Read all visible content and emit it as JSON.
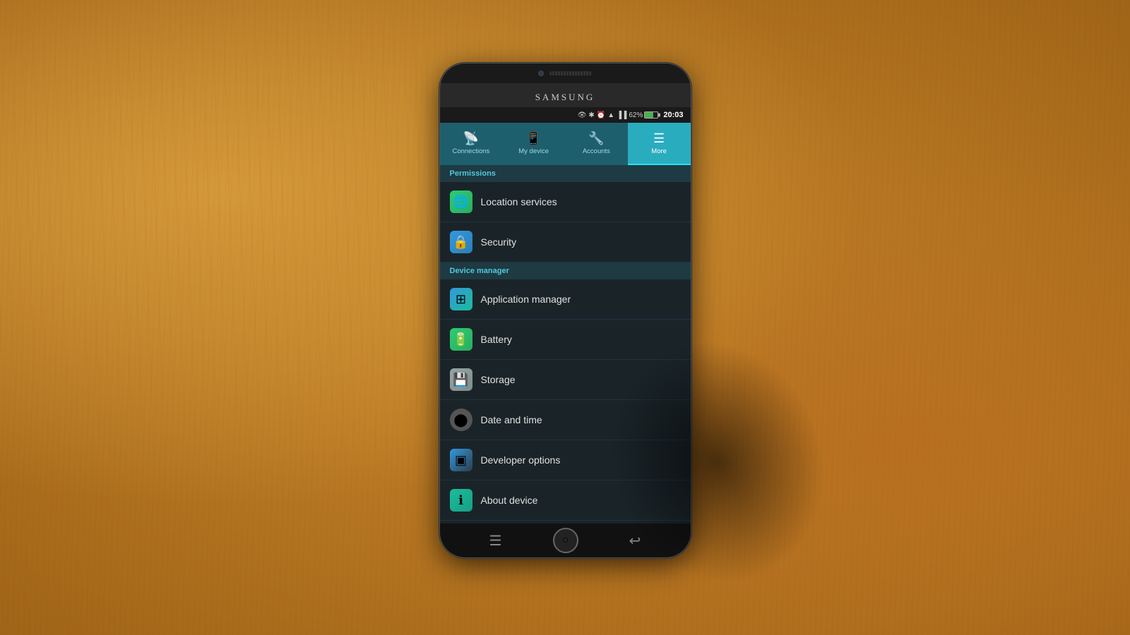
{
  "phone": {
    "brand": "SAMSUNG",
    "time": "20:03",
    "battery_percent": "62%",
    "battery_fill_width": "62%"
  },
  "tabs": [
    {
      "id": "connections",
      "label": "Connections",
      "icon": "📡",
      "active": false
    },
    {
      "id": "my-device",
      "label": "My device",
      "icon": "📱",
      "active": false
    },
    {
      "id": "accounts",
      "label": "Accounts",
      "icon": "🔧",
      "active": false
    },
    {
      "id": "more",
      "label": "More",
      "icon": "☰",
      "active": true
    }
  ],
  "sections": [
    {
      "id": "permissions",
      "header": "Permissions",
      "items": [
        {
          "id": "location-services",
          "label": "Location services",
          "icon": "🌐",
          "icon_class": "icon-location"
        },
        {
          "id": "security",
          "label": "Security",
          "icon": "🔒",
          "icon_class": "icon-security"
        }
      ]
    },
    {
      "id": "device-manager",
      "header": "Device manager",
      "items": [
        {
          "id": "application-manager",
          "label": "Application manager",
          "icon": "⊞",
          "icon_class": "icon-appmanager"
        },
        {
          "id": "battery",
          "label": "Battery",
          "icon": "🔋",
          "icon_class": "icon-battery"
        },
        {
          "id": "storage",
          "label": "Storage",
          "icon": "💾",
          "icon_class": "icon-storage"
        },
        {
          "id": "date-and-time",
          "label": "Date and time",
          "icon": "⬤",
          "icon_class": "icon-datetime"
        },
        {
          "id": "developer-options",
          "label": "Developer options",
          "icon": "▣",
          "icon_class": "icon-developer"
        },
        {
          "id": "about-device",
          "label": "About device",
          "icon": "ℹ",
          "icon_class": "icon-about"
        }
      ]
    }
  ],
  "bottom_bar": {
    "menu_icon": "☰",
    "home_icon": "○",
    "back_icon": "↩"
  }
}
